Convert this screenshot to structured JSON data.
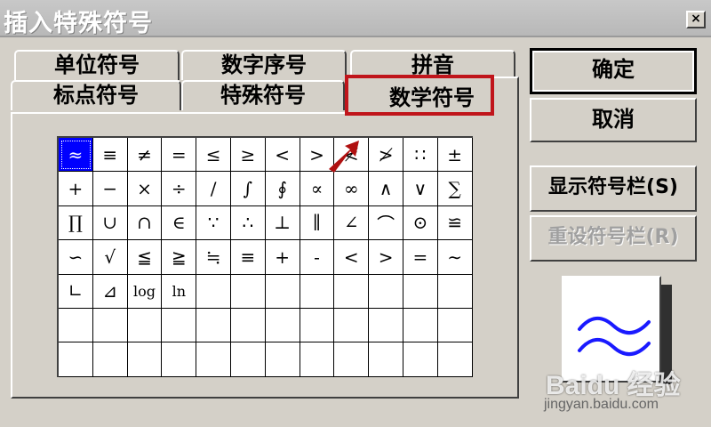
{
  "dialog": {
    "title": "插入特殊符号",
    "close_glyph": "×"
  },
  "tabs": {
    "back_row": [
      "单位符号",
      "数字序号",
      "拼音"
    ],
    "front_row": [
      "标点符号",
      "特殊符号"
    ],
    "active": "数学符号"
  },
  "symbols": [
    [
      "≈",
      "≡",
      "≠",
      "=",
      "≤",
      "≥",
      "<",
      ">",
      "≮",
      "≯",
      "∷",
      "±"
    ],
    [
      "+",
      "−",
      "×",
      "÷",
      "/",
      "∫",
      "∮",
      "∝",
      "∞",
      "∧",
      "∨",
      "∑"
    ],
    [
      "∏",
      "∪",
      "∩",
      "∈",
      "∵",
      "∴",
      "⊥",
      "∥",
      "∠",
      "⌒",
      "⊙",
      "≌"
    ],
    [
      "∽",
      "√",
      "≦",
      "≧",
      "≒",
      "≡",
      "+",
      "-",
      "<",
      ">",
      "=",
      "∼"
    ],
    [
      "∟",
      "⊿",
      "log",
      "ln",
      "",
      "",
      "",
      "",
      "",
      "",
      "",
      ""
    ],
    [
      "",
      "",
      "",
      "",
      "",
      "",
      "",
      "",
      "",
      "",
      "",
      ""
    ],
    [
      "",
      "",
      "",
      "",
      "",
      "",
      "",
      "",
      "",
      "",
      "",
      ""
    ]
  ],
  "buttons": {
    "ok": "确定",
    "cancel": "取消",
    "show_bar": "显示符号栏(S)",
    "reset_bar": "重设符号栏(R)"
  },
  "preview": {
    "symbol": "≈",
    "color": "#1a1aff"
  },
  "watermark": {
    "logo": "Baidu 经验",
    "url": "jingyan.baidu.com"
  }
}
